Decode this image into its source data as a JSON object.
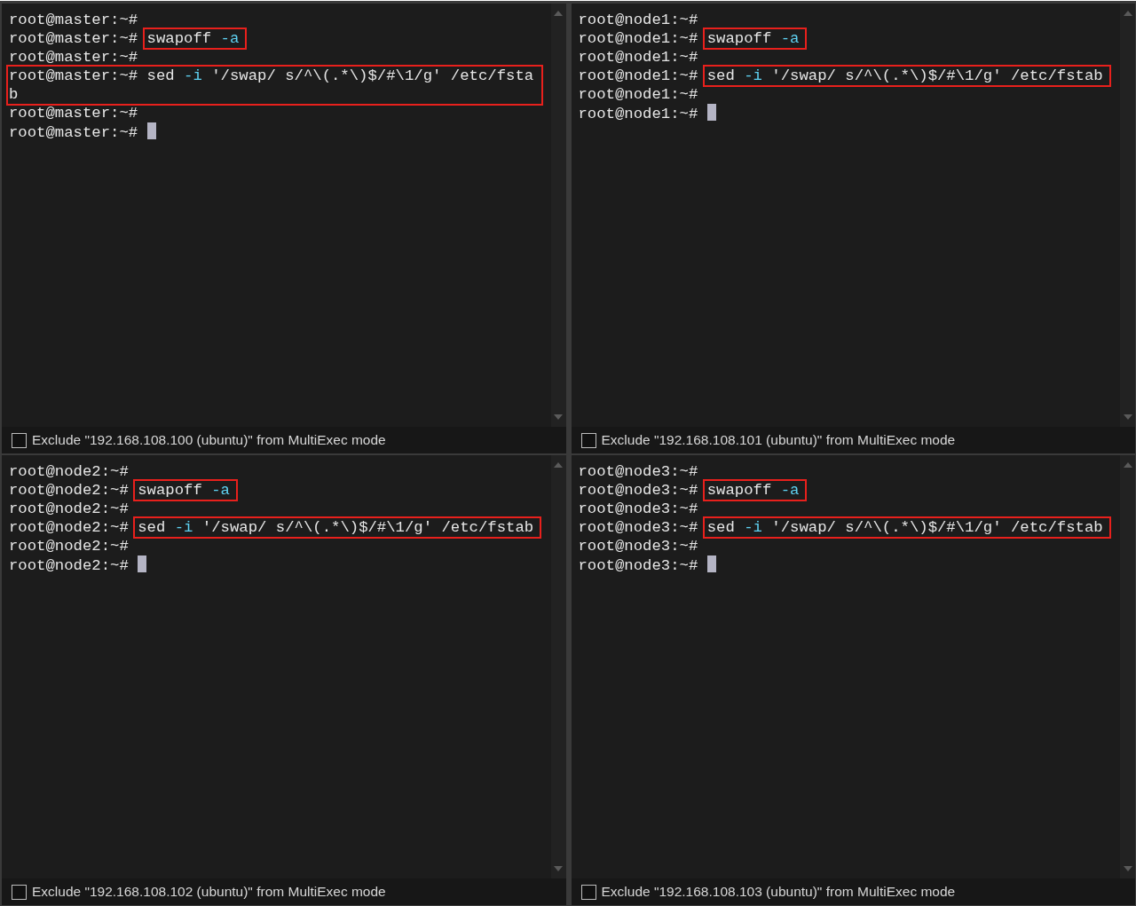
{
  "panes": [
    {
      "lines": [
        {
          "kind": "plain",
          "prompt": "root@master:~#"
        },
        {
          "kind": "boxed",
          "prompt": "root@master:~#",
          "command": [
            {
              "text": "swapoff",
              "kind": "plain"
            },
            {
              "text": "-a",
              "kind": "option"
            }
          ]
        },
        {
          "kind": "plain",
          "prompt": "root@master:~#"
        },
        {
          "kind": "boxed_line",
          "prompt": "root@master:~#",
          "command": [
            {
              "text": "sed",
              "kind": "plain"
            },
            {
              "text": "-i",
              "kind": "option"
            },
            {
              "text": "'/swap/ s/^\\(.*\\)$/#\\1/g'",
              "kind": "plain"
            },
            {
              "text": "/etc/fstab",
              "kind": "plain"
            }
          ]
        },
        {
          "kind": "plain",
          "prompt": "root@master:~#"
        },
        {
          "kind": "plain",
          "prompt": "root@master:~#",
          "cursor": true
        }
      ],
      "exclude": {
        "label": "Exclude \"192.168.108.100 (ubuntu)\" from MultiExec mode",
        "checked": false
      }
    },
    {
      "lines": [
        {
          "kind": "plain",
          "prompt": "root@node1:~#"
        },
        {
          "kind": "boxed",
          "prompt": "root@node1:~#",
          "command": [
            {
              "text": "swapoff",
              "kind": "plain"
            },
            {
              "text": "-a",
              "kind": "option"
            }
          ]
        },
        {
          "kind": "plain",
          "prompt": "root@node1:~#"
        },
        {
          "kind": "boxed",
          "prompt": "root@node1:~#",
          "command": [
            {
              "text": "sed",
              "kind": "plain"
            },
            {
              "text": "-i",
              "kind": "option"
            },
            {
              "text": "'/swap/ s/^\\(.*\\)$/#\\1/g'",
              "kind": "plain"
            },
            {
              "text": "/etc/fstab",
              "kind": "plain"
            }
          ]
        },
        {
          "kind": "plain",
          "prompt": "root@node1:~#"
        },
        {
          "kind": "plain",
          "prompt": "root@node1:~#",
          "cursor": true
        }
      ],
      "exclude": {
        "label": "Exclude \"192.168.108.101 (ubuntu)\" from MultiExec mode",
        "checked": false
      }
    },
    {
      "lines": [
        {
          "kind": "plain",
          "prompt": "root@node2:~#"
        },
        {
          "kind": "boxed",
          "prompt": "root@node2:~#",
          "command": [
            {
              "text": "swapoff",
              "kind": "plain"
            },
            {
              "text": "-a",
              "kind": "option"
            }
          ]
        },
        {
          "kind": "plain",
          "prompt": "root@node2:~#"
        },
        {
          "kind": "boxed",
          "prompt": "root@node2:~#",
          "command": [
            {
              "text": "sed",
              "kind": "plain"
            },
            {
              "text": "-i",
              "kind": "option"
            },
            {
              "text": "'/swap/ s/^\\(.*\\)$/#\\1/g'",
              "kind": "plain"
            },
            {
              "text": "/etc/fstab",
              "kind": "plain"
            }
          ]
        },
        {
          "kind": "plain",
          "prompt": "root@node2:~#"
        },
        {
          "kind": "plain",
          "prompt": "root@node2:~#",
          "cursor": true
        }
      ],
      "exclude": {
        "label": "Exclude \"192.168.108.102 (ubuntu)\" from MultiExec mode",
        "checked": false
      }
    },
    {
      "lines": [
        {
          "kind": "plain",
          "prompt": "root@node3:~#"
        },
        {
          "kind": "boxed",
          "prompt": "root@node3:~#",
          "command": [
            {
              "text": "swapoff",
              "kind": "plain"
            },
            {
              "text": "-a",
              "kind": "option"
            }
          ]
        },
        {
          "kind": "plain",
          "prompt": "root@node3:~#"
        },
        {
          "kind": "boxed",
          "prompt": "root@node3:~#",
          "command": [
            {
              "text": "sed",
              "kind": "plain"
            },
            {
              "text": "-i",
              "kind": "option"
            },
            {
              "text": "'/swap/ s/^\\(.*\\)$/#\\1/g'",
              "kind": "plain"
            },
            {
              "text": "/etc/fstab",
              "kind": "plain"
            }
          ]
        },
        {
          "kind": "plain",
          "prompt": "root@node3:~#"
        },
        {
          "kind": "plain",
          "prompt": "root@node3:~#",
          "cursor": true
        }
      ],
      "exclude": {
        "label": "Exclude \"192.168.108.103 (ubuntu)\" from MultiExec mode",
        "checked": false
      }
    }
  ]
}
